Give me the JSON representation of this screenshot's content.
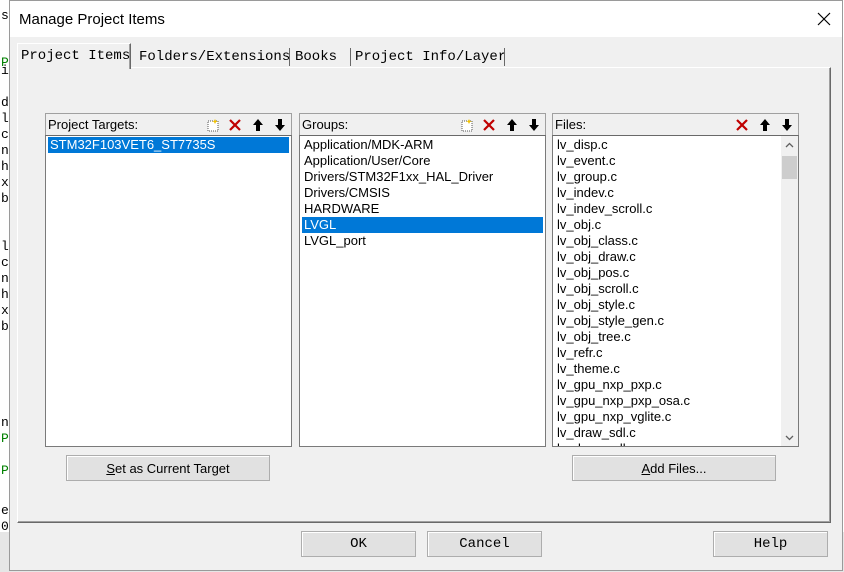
{
  "window": {
    "title": "Manage Project Items"
  },
  "background_editor": {
    "glyphs": [
      "s",
      "P",
      "i",
      "d",
      "l",
      "c",
      "n",
      "h",
      "x",
      "b",
      "l",
      "c",
      "n",
      "h",
      "x",
      "b",
      "n",
      "P",
      "P",
      "e",
      "0"
    ]
  },
  "tabs": [
    {
      "label": "Project Items",
      "active": true
    },
    {
      "label": "Folders/Extensions",
      "active": false
    },
    {
      "label": "Books",
      "active": false
    },
    {
      "label": "Project Info/Layer",
      "active": false
    }
  ],
  "targets_panel": {
    "label": "Project Targets:",
    "items": [
      "STM32F103VET6_ST7735S"
    ],
    "selected_index": 0
  },
  "groups_panel": {
    "label": "Groups:",
    "items": [
      "Application/MDK-ARM",
      "Application/User/Core",
      "Drivers/STM32F1xx_HAL_Driver",
      "Drivers/CMSIS",
      "HARDWARE",
      "LVGL",
      "LVGL_port"
    ],
    "selected_index": 5
  },
  "files_panel": {
    "label": "Files:",
    "items": [
      "lv_disp.c",
      "lv_event.c",
      "lv_group.c",
      "lv_indev.c",
      "lv_indev_scroll.c",
      "lv_obj.c",
      "lv_obj_class.c",
      "lv_obj_draw.c",
      "lv_obj_pos.c",
      "lv_obj_scroll.c",
      "lv_obj_style.c",
      "lv_obj_style_gen.c",
      "lv_obj_tree.c",
      "lv_refr.c",
      "lv_theme.c",
      "lv_gpu_nxp_pxp.c",
      "lv_gpu_nxp_pxp_osa.c",
      "lv_gpu_nxp_vglite.c",
      "lv_draw_sdl.c",
      "lv_draw_sdl_..."
    ]
  },
  "buttons": {
    "set_current_target_access": "S",
    "set_current_target_rest": "et as Current Target",
    "add_files_access": "A",
    "add_files_rest": "dd Files...",
    "ok": "OK",
    "cancel": "Cancel",
    "help": "Help"
  },
  "colors": {
    "selection": "#0078d7",
    "dialog_bg": "#f0f0f0",
    "delete_red": "#c00000"
  }
}
